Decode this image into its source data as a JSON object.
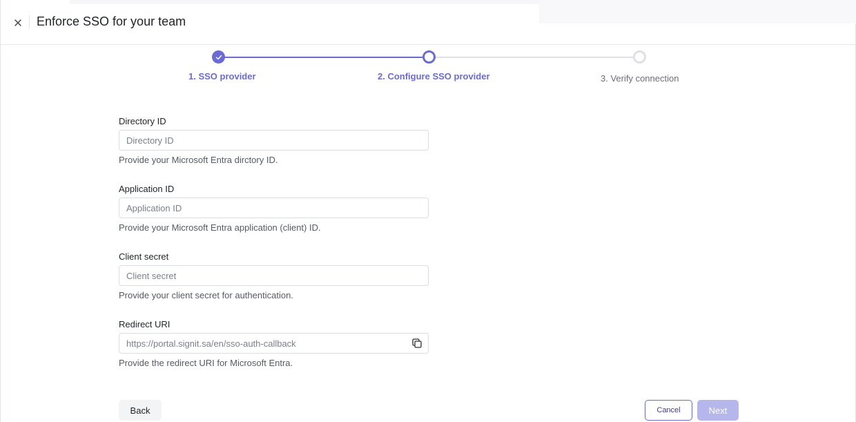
{
  "header": {
    "title": "Enforce SSO for your team",
    "close_icon": "close-icon"
  },
  "stepper": {
    "steps": [
      {
        "label": "1. SSO provider",
        "state": "complete"
      },
      {
        "label": "2. Configure SSO provider",
        "state": "current"
      },
      {
        "label": "3. Verify connection",
        "state": "pending"
      }
    ],
    "accent_color": "#6b6bd6"
  },
  "form": {
    "directory_id": {
      "label": "Directory ID",
      "placeholder": "Directory ID",
      "value": "",
      "help": "Provide your Microsoft Entra dirctory ID."
    },
    "application_id": {
      "label": "Application ID",
      "placeholder": "Application ID",
      "value": "",
      "help": "Provide your Microsoft Entra application (client) ID."
    },
    "client_secret": {
      "label": "Client secret",
      "placeholder": "Client secret",
      "value": "",
      "help": "Provide your client secret for authentication."
    },
    "redirect_uri": {
      "label": "Redirect URI",
      "value": "https://portal.signit.sa/en/sso-auth-callback",
      "help": "Provide the redirect URI for Microsoft Entra.",
      "copy_icon": "copy-icon"
    }
  },
  "footer": {
    "back_label": "Back",
    "cancel_label": "Cancel",
    "next_label": "Next"
  }
}
